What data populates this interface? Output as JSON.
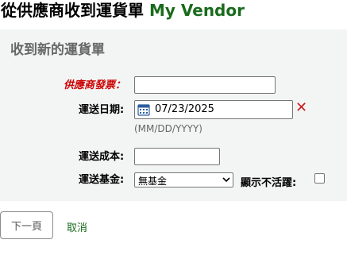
{
  "header": {
    "title_prefix": "從供應商收到運貨單",
    "vendor_name": "My Vendor"
  },
  "form": {
    "legend": "收到新的運貨單",
    "invoice_label": "供應商發票：",
    "invoice_value": "",
    "shipment_date_label": "運送日期:",
    "shipment_date_value": "07/23/2025",
    "date_format_hint": "(MM/DD/YYYY)",
    "shipping_cost_label": "運送成本:",
    "shipping_cost_value": "",
    "shipping_fund_label": "運送基金:",
    "shipping_fund_selected": "無基金",
    "show_inactive_label": "顯示不活躍:",
    "show_inactive_checked": false
  },
  "actions": {
    "next_label": "下一頁",
    "cancel_label": "取消"
  },
  "colors": {
    "vendor_green": "#196b1c",
    "required_red": "#cc0000",
    "clear_red": "#cc1b1b",
    "panel_bg": "#f3f4f4"
  },
  "icons": {
    "calendar": "calendar-icon",
    "clear": "clear-date-icon",
    "dropdown": "chevron-down-icon"
  }
}
